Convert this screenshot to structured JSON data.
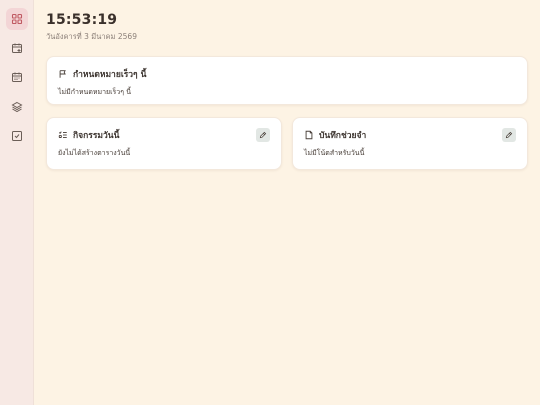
{
  "sidebar": {
    "items": [
      {
        "icon": "grid-icon",
        "active": true
      },
      {
        "icon": "calendar-plus-icon",
        "active": false
      },
      {
        "icon": "calendar-icon",
        "active": false
      },
      {
        "icon": "layers-icon",
        "active": false
      },
      {
        "icon": "checkbox-icon",
        "active": false
      }
    ]
  },
  "header": {
    "time": "15:53:19",
    "date": "วันอังคารที่ 3 มีนาคม 2569"
  },
  "goal_card": {
    "icon": "flag-icon",
    "title": "กำหนดหมายเร็วๆ นี้",
    "body": "ไม่มีกำหนดหมายเร็วๆ นี้"
  },
  "activities_card": {
    "icon": "list-checks-icon",
    "title": "กิจกรรมวันนี้",
    "body": "ยังไม่ได้สร้างตารางวันนี้",
    "edit_icon": "pencil-icon"
  },
  "notes_card": {
    "icon": "note-icon",
    "title": "บันทึกช่วยจำ",
    "body": "ไม่มีโน้ตสำหรับวันนี้",
    "edit_icon": "pencil-icon"
  },
  "colors": {
    "background": "#fdf3e4",
    "sidebar": "#f7e9e4",
    "active_highlight": "#f3d5d6",
    "accent_icon": "#c05a63"
  }
}
